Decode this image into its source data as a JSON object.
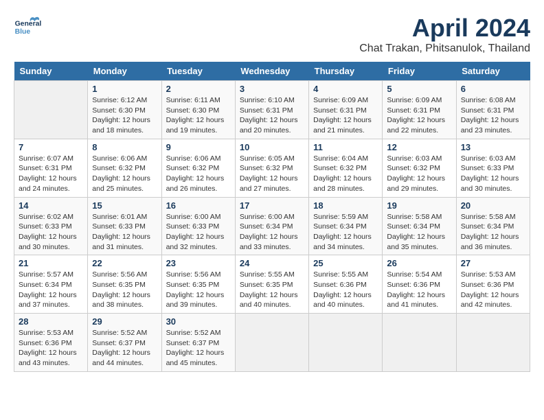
{
  "header": {
    "logo_general": "General",
    "logo_blue": "Blue",
    "month_title": "April 2024",
    "location": "Chat Trakan, Phitsanulok, Thailand"
  },
  "days_of_week": [
    "Sunday",
    "Monday",
    "Tuesday",
    "Wednesday",
    "Thursday",
    "Friday",
    "Saturday"
  ],
  "weeks": [
    [
      {
        "day": "",
        "info": ""
      },
      {
        "day": "1",
        "info": "Sunrise: 6:12 AM\nSunset: 6:30 PM\nDaylight: 12 hours\nand 18 minutes."
      },
      {
        "day": "2",
        "info": "Sunrise: 6:11 AM\nSunset: 6:30 PM\nDaylight: 12 hours\nand 19 minutes."
      },
      {
        "day": "3",
        "info": "Sunrise: 6:10 AM\nSunset: 6:31 PM\nDaylight: 12 hours\nand 20 minutes."
      },
      {
        "day": "4",
        "info": "Sunrise: 6:09 AM\nSunset: 6:31 PM\nDaylight: 12 hours\nand 21 minutes."
      },
      {
        "day": "5",
        "info": "Sunrise: 6:09 AM\nSunset: 6:31 PM\nDaylight: 12 hours\nand 22 minutes."
      },
      {
        "day": "6",
        "info": "Sunrise: 6:08 AM\nSunset: 6:31 PM\nDaylight: 12 hours\nand 23 minutes."
      }
    ],
    [
      {
        "day": "7",
        "info": "Sunrise: 6:07 AM\nSunset: 6:31 PM\nDaylight: 12 hours\nand 24 minutes."
      },
      {
        "day": "8",
        "info": "Sunrise: 6:06 AM\nSunset: 6:32 PM\nDaylight: 12 hours\nand 25 minutes."
      },
      {
        "day": "9",
        "info": "Sunrise: 6:06 AM\nSunset: 6:32 PM\nDaylight: 12 hours\nand 26 minutes."
      },
      {
        "day": "10",
        "info": "Sunrise: 6:05 AM\nSunset: 6:32 PM\nDaylight: 12 hours\nand 27 minutes."
      },
      {
        "day": "11",
        "info": "Sunrise: 6:04 AM\nSunset: 6:32 PM\nDaylight: 12 hours\nand 28 minutes."
      },
      {
        "day": "12",
        "info": "Sunrise: 6:03 AM\nSunset: 6:32 PM\nDaylight: 12 hours\nand 29 minutes."
      },
      {
        "day": "13",
        "info": "Sunrise: 6:03 AM\nSunset: 6:33 PM\nDaylight: 12 hours\nand 30 minutes."
      }
    ],
    [
      {
        "day": "14",
        "info": "Sunrise: 6:02 AM\nSunset: 6:33 PM\nDaylight: 12 hours\nand 30 minutes."
      },
      {
        "day": "15",
        "info": "Sunrise: 6:01 AM\nSunset: 6:33 PM\nDaylight: 12 hours\nand 31 minutes."
      },
      {
        "day": "16",
        "info": "Sunrise: 6:00 AM\nSunset: 6:33 PM\nDaylight: 12 hours\nand 32 minutes."
      },
      {
        "day": "17",
        "info": "Sunrise: 6:00 AM\nSunset: 6:34 PM\nDaylight: 12 hours\nand 33 minutes."
      },
      {
        "day": "18",
        "info": "Sunrise: 5:59 AM\nSunset: 6:34 PM\nDaylight: 12 hours\nand 34 minutes."
      },
      {
        "day": "19",
        "info": "Sunrise: 5:58 AM\nSunset: 6:34 PM\nDaylight: 12 hours\nand 35 minutes."
      },
      {
        "day": "20",
        "info": "Sunrise: 5:58 AM\nSunset: 6:34 PM\nDaylight: 12 hours\nand 36 minutes."
      }
    ],
    [
      {
        "day": "21",
        "info": "Sunrise: 5:57 AM\nSunset: 6:34 PM\nDaylight: 12 hours\nand 37 minutes."
      },
      {
        "day": "22",
        "info": "Sunrise: 5:56 AM\nSunset: 6:35 PM\nDaylight: 12 hours\nand 38 minutes."
      },
      {
        "day": "23",
        "info": "Sunrise: 5:56 AM\nSunset: 6:35 PM\nDaylight: 12 hours\nand 39 minutes."
      },
      {
        "day": "24",
        "info": "Sunrise: 5:55 AM\nSunset: 6:35 PM\nDaylight: 12 hours\nand 40 minutes."
      },
      {
        "day": "25",
        "info": "Sunrise: 5:55 AM\nSunset: 6:36 PM\nDaylight: 12 hours\nand 40 minutes."
      },
      {
        "day": "26",
        "info": "Sunrise: 5:54 AM\nSunset: 6:36 PM\nDaylight: 12 hours\nand 41 minutes."
      },
      {
        "day": "27",
        "info": "Sunrise: 5:53 AM\nSunset: 6:36 PM\nDaylight: 12 hours\nand 42 minutes."
      }
    ],
    [
      {
        "day": "28",
        "info": "Sunrise: 5:53 AM\nSunset: 6:36 PM\nDaylight: 12 hours\nand 43 minutes."
      },
      {
        "day": "29",
        "info": "Sunrise: 5:52 AM\nSunset: 6:37 PM\nDaylight: 12 hours\nand 44 minutes."
      },
      {
        "day": "30",
        "info": "Sunrise: 5:52 AM\nSunset: 6:37 PM\nDaylight: 12 hours\nand 45 minutes."
      },
      {
        "day": "",
        "info": ""
      },
      {
        "day": "",
        "info": ""
      },
      {
        "day": "",
        "info": ""
      },
      {
        "day": "",
        "info": ""
      }
    ]
  ]
}
